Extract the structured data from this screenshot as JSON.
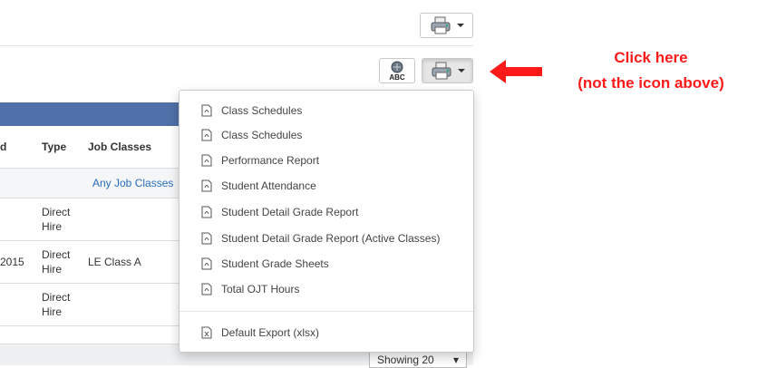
{
  "toolbar": {
    "print_icon": "printer-icon",
    "spellcheck_icon": "abc-spellcheck-icon",
    "spellcheck_text": "ABC"
  },
  "table": {
    "headers": [
      "d",
      "Type",
      "Job Classes"
    ],
    "filter": {
      "job_classes": "Any Job Classes"
    },
    "rows": [
      {
        "date": "",
        "type": "Direct Hire",
        "job_class": ""
      },
      {
        "date": "2015",
        "type": "Direct Hire",
        "job_class": "LE Class A"
      },
      {
        "date": "",
        "type": "Direct Hire",
        "job_class": ""
      }
    ]
  },
  "footer": {
    "showing": "Showing 20"
  },
  "menu": {
    "items": [
      "Class Schedules",
      "Class Schedules",
      "Performance Report",
      "Student Attendance",
      "Student Detail Grade Report",
      "Student Detail Grade Report (Active Classes)",
      "Student Grade Sheets",
      "Total OJT Hours"
    ],
    "export": "Default Export (xlsx)"
  },
  "annotation": {
    "line1": "Click here",
    "line2": "(not the icon above)",
    "color": "#ff1a1a"
  }
}
